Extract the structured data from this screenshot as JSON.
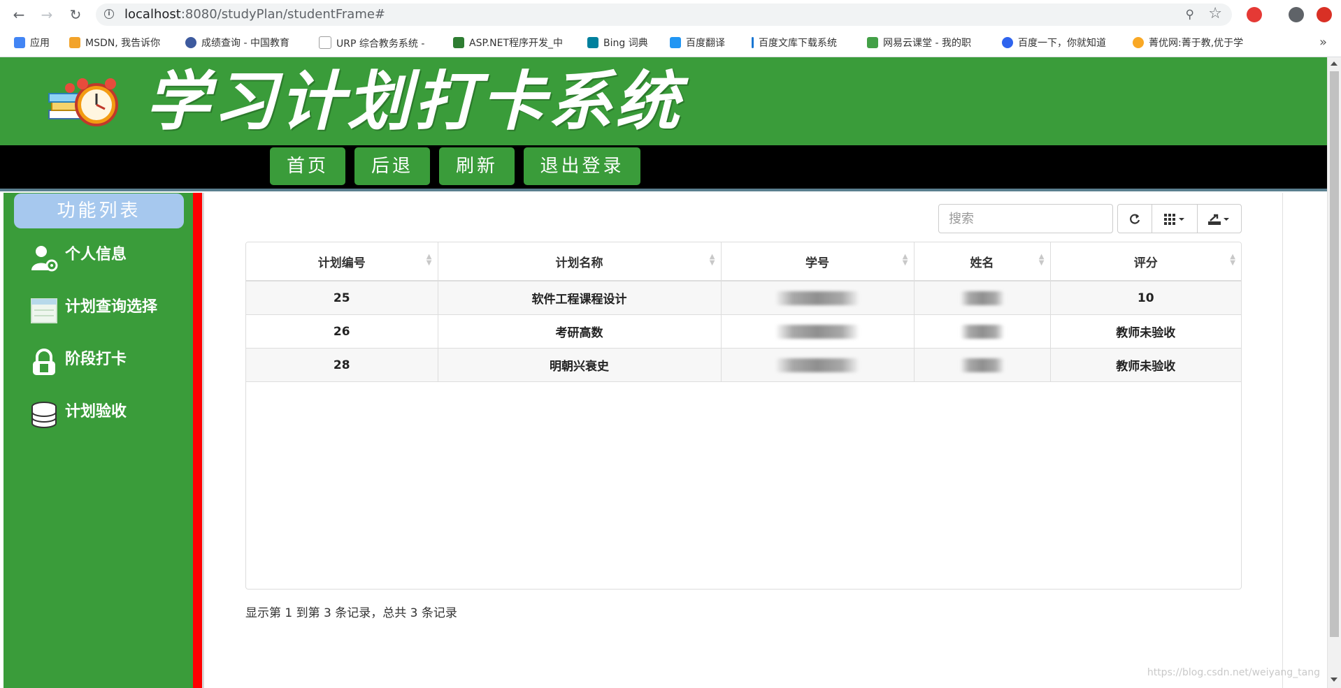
{
  "browser": {
    "url_host": "localhost",
    "url_path": ":8080/studyPlan/studentFrame#",
    "bookmarks": [
      {
        "label": "应用",
        "color": "#4285f4"
      },
      {
        "label": "MSDN, 我告诉你",
        "color": "#f2a32a"
      },
      {
        "label": "成绩查询 - 中国教育",
        "color": "#3d5a9e"
      },
      {
        "label": "URP 综合教务系统 -",
        "color": "#9e9e9e"
      },
      {
        "label": "ASP.NET程序开发_中",
        "color": "#2e7d32"
      },
      {
        "label": "Bing 词典",
        "color": "#00809d"
      },
      {
        "label": "百度翻译",
        "color": "#2196f3"
      },
      {
        "label": "百度文库下载系统",
        "color": "#1976d2"
      },
      {
        "label": "网易云课堂 - 我的职",
        "color": "#43a047"
      },
      {
        "label": "百度一下，你就知道",
        "color": "#2f64ee"
      },
      {
        "label": "菁优网:菁于教,优于学",
        "color": "#f9a825"
      }
    ],
    "bookmarks_more": "»"
  },
  "app": {
    "title": "学习计划打卡系统",
    "nav": [
      "首页",
      "后退",
      "刷新",
      "退出登录"
    ]
  },
  "sidebar": {
    "title": "功能列表",
    "items": [
      {
        "label": "个人信息",
        "icon": "user-settings-icon"
      },
      {
        "label": "计划查询选择",
        "icon": "calendar-icon"
      },
      {
        "label": "阶段打卡",
        "icon": "lock-icon"
      },
      {
        "label": "计划验收",
        "icon": "database-icon"
      }
    ]
  },
  "toolbar": {
    "search_placeholder": "搜索",
    "refresh_icon": "refresh-icon",
    "columns_icon": "columns-icon",
    "export_icon": "export-icon"
  },
  "table": {
    "columns": [
      "计划编号",
      "计划名称",
      "学号",
      "姓名",
      "评分"
    ],
    "rows": [
      {
        "id": "25",
        "name": "软件工程课程设计",
        "score": "10"
      },
      {
        "id": "26",
        "name": "考研高数",
        "score": "教师未验收"
      },
      {
        "id": "28",
        "name": "明朝兴衰史",
        "score": "教师未验收"
      }
    ]
  },
  "pagination": {
    "info": "显示第 1 到第 3 条记录，总共 3 条记录"
  },
  "watermark": "https://blog.csdn.net/weiyang_tang"
}
